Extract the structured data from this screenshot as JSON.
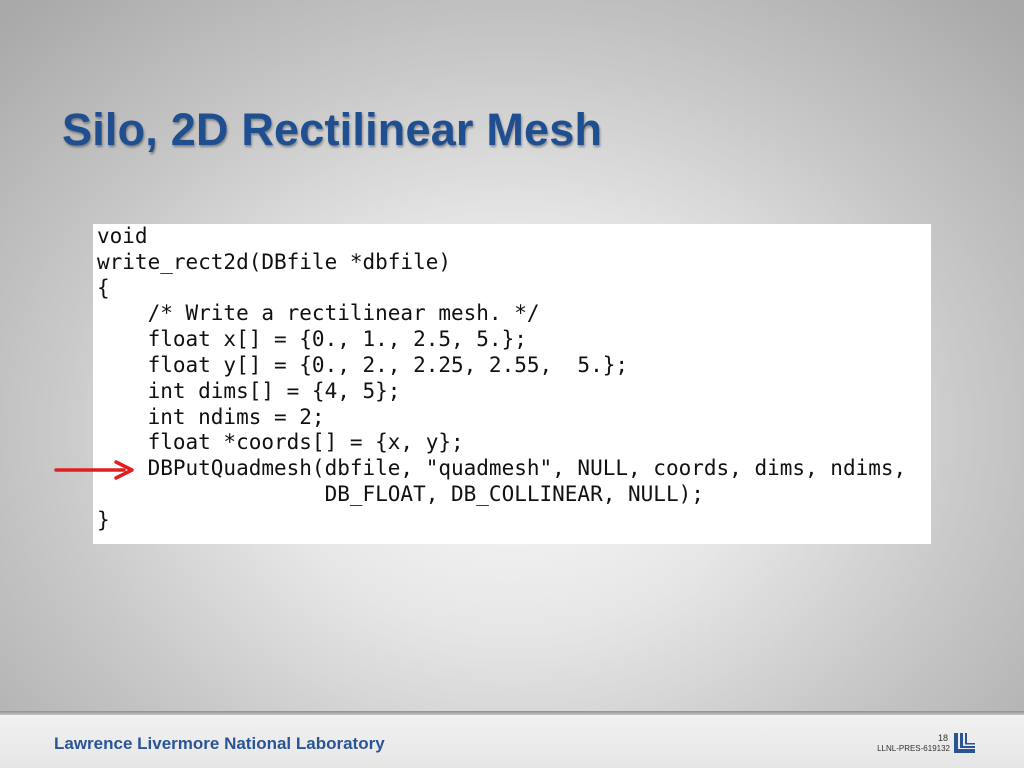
{
  "slide": {
    "title": "Silo, 2D Rectilinear Mesh"
  },
  "code": {
    "lines": [
      "void",
      "write_rect2d(DBfile *dbfile)",
      "{",
      "    /* Write a rectilinear mesh. */",
      "    float x[] = {0., 1., 2.5, 5.};",
      "    float y[] = {0., 2., 2.25, 2.55,  5.};",
      "    int dims[] = {4, 5};",
      "    int ndims = 2;",
      "    float *coords[] = {x, y};",
      "    DBPutQuadmesh(dbfile, \"quadmesh\", NULL, coords, dims, ndims,",
      "                  DB_FLOAT, DB_COLLINEAR, NULL);",
      "}"
    ],
    "highlighted_line": 10
  },
  "footer": {
    "lab_name": "Lawrence Livermore National Laboratory",
    "page_number": "18",
    "doc_id": "LLNL-PRES-619132"
  },
  "colors": {
    "title": "#1f4f90",
    "arrow": "#e02020",
    "footer_text": "#2a5595"
  },
  "icons": {
    "arrow": "red-arrow-icon",
    "logo": "llnl-logo-icon"
  }
}
